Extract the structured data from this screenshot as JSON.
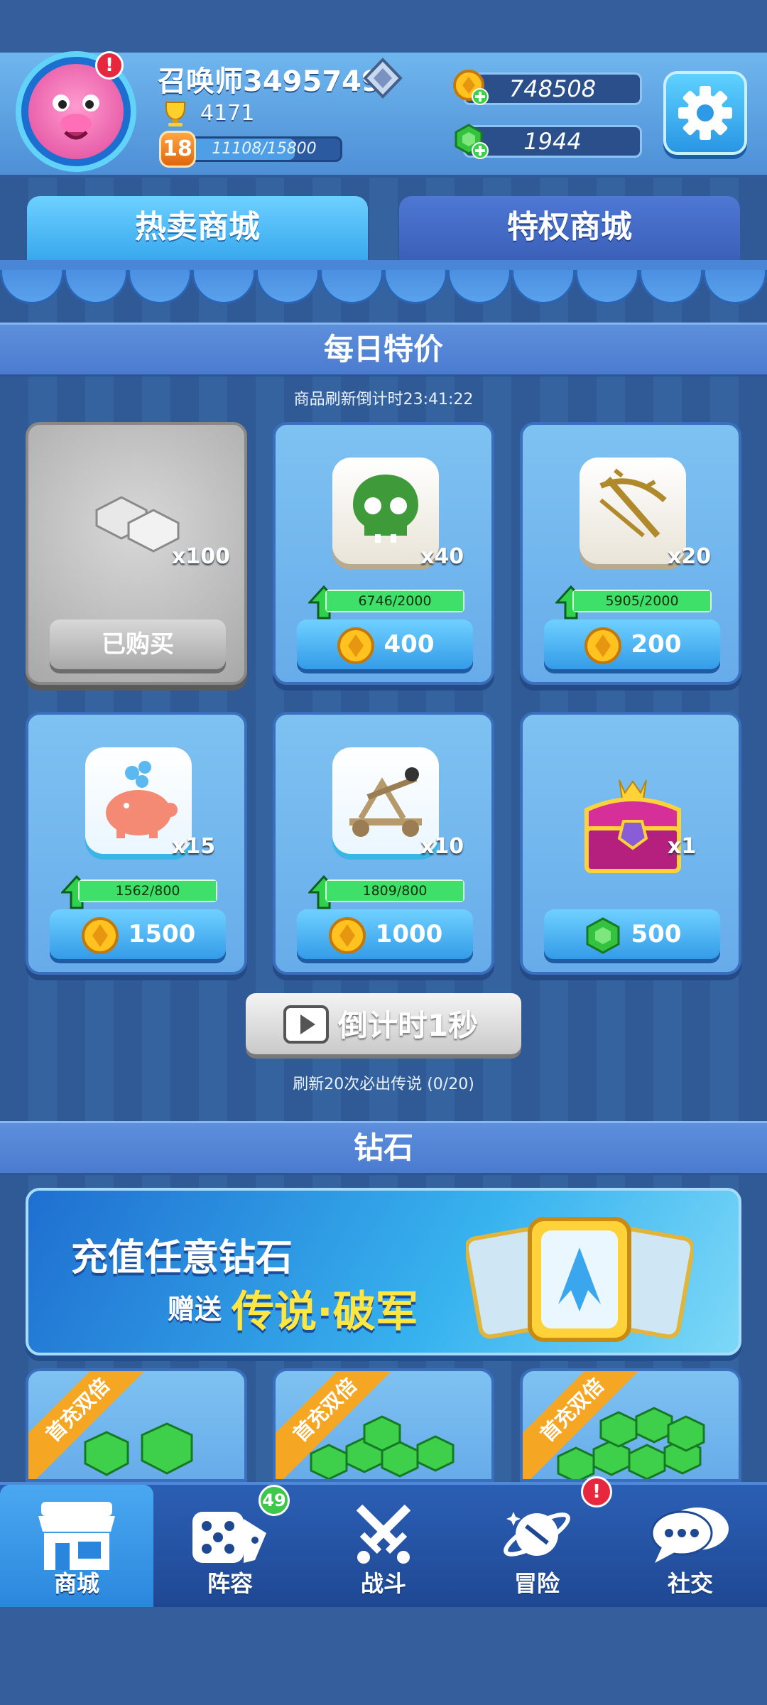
{
  "profile": {
    "name": "召唤师3495749",
    "trophies": "4171",
    "level": "18",
    "xp_text": "11108/15800",
    "xp_fraction": 0.7,
    "alert": "!"
  },
  "currency": {
    "gold": "748508",
    "gems": "1944"
  },
  "tabs": [
    {
      "label": "热卖商城",
      "active": true
    },
    {
      "label": "特权商城",
      "active": false
    }
  ],
  "daily": {
    "title": "每日特价",
    "refresh_text": "商品刷新倒计时23:41:22",
    "items": [
      {
        "qty": "x100",
        "progress": "",
        "price": "",
        "button": "已购买",
        "sold": true,
        "icon": "silver-ingot-icon"
      },
      {
        "qty": "x40",
        "progress": "6746/2000",
        "price": "400",
        "currency": "gold",
        "icon": "skull-icon"
      },
      {
        "qty": "x20",
        "progress": "5905/2000",
        "price": "200",
        "currency": "gold",
        "icon": "crossbow-icon"
      },
      {
        "qty": "x15",
        "progress": "1562/800",
        "price": "1500",
        "currency": "gold",
        "icon": "piggy-bank-icon"
      },
      {
        "qty": "x10",
        "progress": "1809/800",
        "price": "1000",
        "currency": "gold",
        "icon": "catapult-icon"
      },
      {
        "qty": "x1",
        "progress": "",
        "price": "500",
        "currency": "gem",
        "icon": "treasure-chest-icon"
      }
    ],
    "watch_button": "倒计时1秒",
    "legend_hint": "刷新20次必出传说 (0/20)"
  },
  "diamond": {
    "title": "钻石",
    "banner_line1": "充值任意钻石",
    "banner_gift": "赠送",
    "banner_highlight": "传说·破军",
    "ribbon": "首充双倍"
  },
  "nav": [
    {
      "label": "商城",
      "icon": "shop-icon",
      "badge": ""
    },
    {
      "label": "阵容",
      "icon": "dice-icon",
      "badge": "49"
    },
    {
      "label": "战斗",
      "icon": "crossed-swords-icon",
      "badge": ""
    },
    {
      "label": "冒险",
      "icon": "planet-icon",
      "badge": "!"
    },
    {
      "label": "社交",
      "icon": "chat-icon",
      "badge": ""
    }
  ]
}
